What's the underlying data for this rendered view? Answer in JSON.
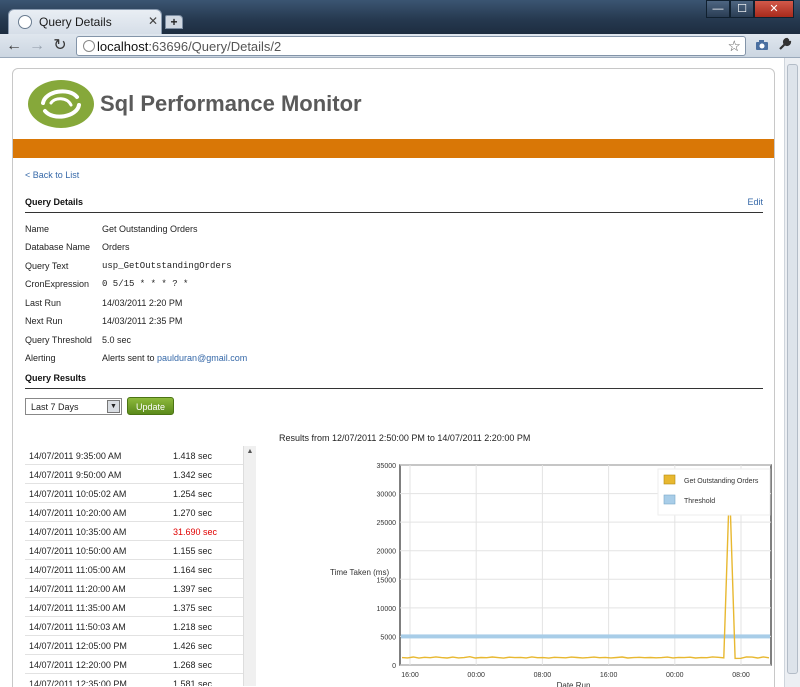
{
  "browser": {
    "tab_title": "Query Details",
    "tab_close": "✕",
    "new_tab": "+",
    "win_min": "—",
    "win_max": "☐",
    "win_close": "✕",
    "back": "←",
    "forward": "→",
    "reload": "↻",
    "url_host": "localhost",
    "url_rest": ":63696/Query/Details/2",
    "star": "☆"
  },
  "header": {
    "site_title": "Sql Performance Monitor",
    "brand_color": "#d97706",
    "logo_color": "#86a83a"
  },
  "nav": {
    "back_link": "< Back to List"
  },
  "details": {
    "heading": "Query Details",
    "edit": "Edit",
    "rows": [
      {
        "label": "Name",
        "value": "Get Outstanding Orders"
      },
      {
        "label": "Database Name",
        "value": "Orders"
      },
      {
        "label": "Query Text",
        "value": "usp_GetOutstandingOrders"
      },
      {
        "label": "CronExpression",
        "value": "0 5/15 * * * ? *"
      },
      {
        "label": "Last Run",
        "value": "14/03/2011 2:20 PM"
      },
      {
        "label": "Next Run",
        "value": "14/03/2011 2:35 PM"
      },
      {
        "label": "Query Threshold",
        "value": "5.0 sec"
      },
      {
        "label": "Alerting",
        "value_prefix": "Alerts sent to ",
        "email": "paulduran@gmail.com"
      }
    ]
  },
  "results": {
    "heading": "Query Results",
    "range_select": "Last 7 Days",
    "update_button": "Update",
    "range_text": "Results from 12/07/2011 2:50:00 PM to 14/07/2011 2:20:00 PM",
    "alert_color": "#e00000",
    "rows": [
      {
        "date": "14/07/2011 9:35:00 AM",
        "time": "1.418 sec",
        "alert": false
      },
      {
        "date": "14/07/2011 9:50:00 AM",
        "time": "1.342 sec",
        "alert": false
      },
      {
        "date": "14/07/2011 10:05:02 AM",
        "time": "1.254 sec",
        "alert": false
      },
      {
        "date": "14/07/2011 10:20:00 AM",
        "time": "1.270 sec",
        "alert": false
      },
      {
        "date": "14/07/2011 10:35:00 AM",
        "time": "31.690 sec",
        "alert": true
      },
      {
        "date": "14/07/2011 10:50:00 AM",
        "time": "1.155 sec",
        "alert": false
      },
      {
        "date": "14/07/2011 11:05:00 AM",
        "time": "1.164 sec",
        "alert": false
      },
      {
        "date": "14/07/2011 11:20:00 AM",
        "time": "1.397 sec",
        "alert": false
      },
      {
        "date": "14/07/2011 11:35:00 AM",
        "time": "1.375 sec",
        "alert": false
      },
      {
        "date": "14/07/2011 11:50:03 AM",
        "time": "1.218 sec",
        "alert": false
      },
      {
        "date": "14/07/2011 12:05:00 PM",
        "time": "1.426 sec",
        "alert": false
      },
      {
        "date": "14/07/2011 12:20:00 PM",
        "time": "1.268 sec",
        "alert": false
      },
      {
        "date": "14/07/2011 12:35:00 PM",
        "time": "1.581 sec",
        "alert": false
      }
    ]
  },
  "chart_data": {
    "type": "line",
    "xlabel": "Date Run",
    "ylabel": "Time Taken (ms)",
    "ylim": [
      0,
      35000
    ],
    "yticks": [
      0,
      5000,
      10000,
      15000,
      20000,
      25000,
      30000,
      35000
    ],
    "xticks": [
      "16:00",
      "00:00",
      "08:00",
      "16:00",
      "00:00",
      "08:00"
    ],
    "legend_position": "top-right",
    "grid": true,
    "series": [
      {
        "name": "Get Outstanding Orders",
        "color": "#e8b830",
        "values": [
          1300,
          1250,
          1400,
          1200,
          1350,
          1280,
          1420,
          1300,
          1220,
          1380,
          1250,
          1300,
          1450,
          1230,
          1320,
          1270,
          1400,
          1300,
          1210,
          1360,
          1290,
          1330,
          1250,
          1410,
          1280,
          1300,
          1200,
          1350,
          1300,
          1260,
          1390,
          1320,
          1240,
          1300,
          1380,
          1270,
          1330,
          1250,
          1310,
          1400,
          1230,
          1290,
          1350,
          1270,
          1320,
          1260,
          1300,
          1380,
          1250,
          1330,
          1290,
          1360,
          1220,
          1300,
          1270,
          1418,
          1342,
          1254,
          31690,
          1155,
          1164,
          1397,
          1375,
          1218,
          1426,
          1268
        ]
      },
      {
        "name": "Threshold",
        "color": "#a8cde8",
        "values": [
          5000,
          5000
        ]
      }
    ]
  }
}
